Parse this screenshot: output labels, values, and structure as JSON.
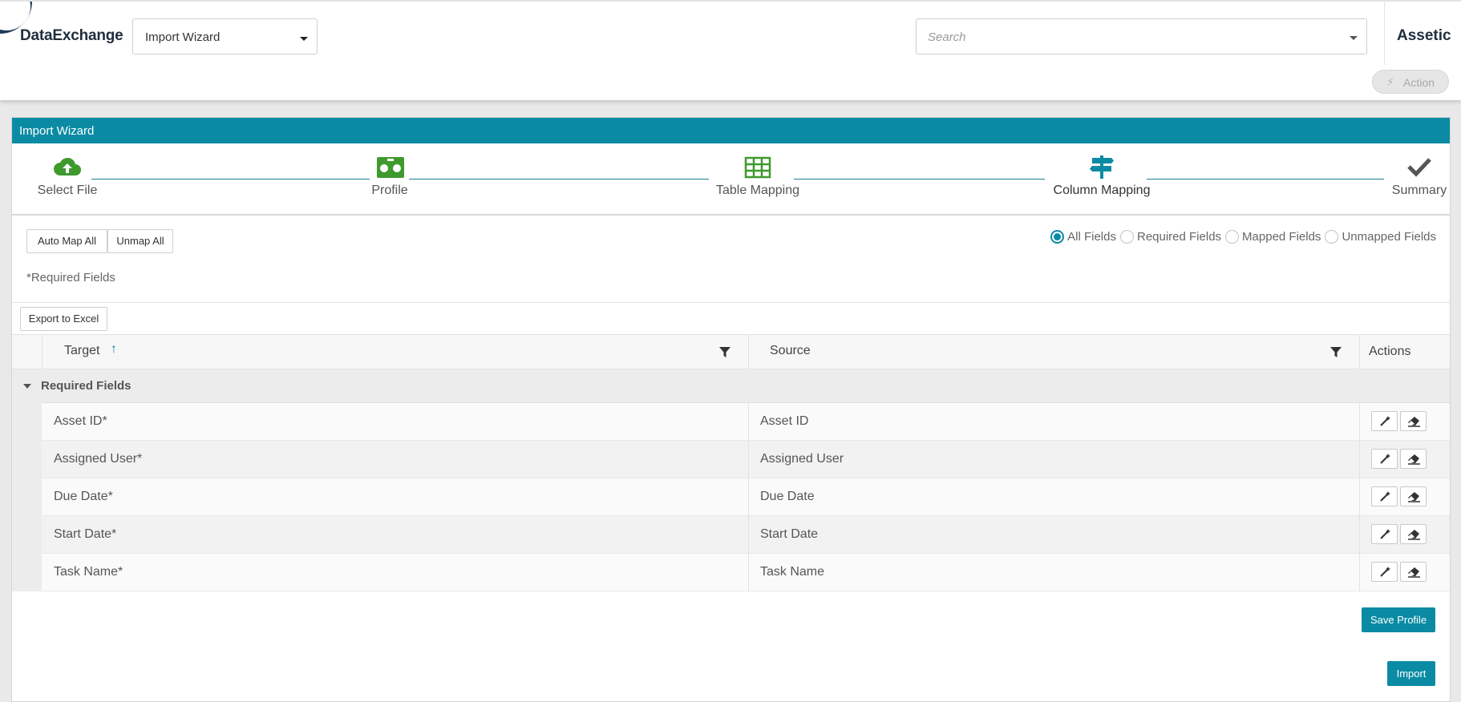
{
  "header": {
    "brand": "DataExchange",
    "module_select": "Import Wizard",
    "search_placeholder": "Search",
    "org_name": "Assetic"
  },
  "actionbar": {
    "action_label": "Action"
  },
  "panel": {
    "title": "Import Wizard"
  },
  "stepper": {
    "steps": [
      {
        "label": "Select File",
        "icon": "cloud-upload-icon",
        "color": "#3f9a2e"
      },
      {
        "label": "Profile",
        "icon": "profile-icon",
        "color": "#3f9a2e"
      },
      {
        "label": "Table Mapping",
        "icon": "table-icon",
        "color": "#3f9a2e"
      },
      {
        "label": "Column Mapping",
        "icon": "signpost-icon",
        "color": "#0a8ba3",
        "active": true
      },
      {
        "label": "Summary",
        "icon": "check-icon",
        "color": "#555555"
      }
    ]
  },
  "toolbar": {
    "auto_map_all": "Auto Map All",
    "unmap_all": "Unmap All",
    "required_note": "*Required Fields",
    "export_excel": "Export to Excel"
  },
  "filters": {
    "options": [
      "All Fields",
      "Required Fields",
      "Mapped Fields",
      "Unmapped Fields"
    ],
    "selected": "All Fields"
  },
  "grid": {
    "columns": {
      "target": "Target",
      "source": "Source",
      "actions": "Actions"
    },
    "group_label": "Required Fields",
    "rows": [
      {
        "target": "Asset ID*",
        "source": "Asset ID"
      },
      {
        "target": "Assigned User*",
        "source": "Assigned User"
      },
      {
        "target": "Due Date*",
        "source": "Due Date"
      },
      {
        "target": "Start Date*",
        "source": "Start Date"
      },
      {
        "target": "Task Name*",
        "source": "Task Name"
      }
    ]
  },
  "footer": {
    "save_profile": "Save Profile",
    "import": "Import"
  },
  "colors": {
    "accent": "#0a8ba3",
    "step_done": "#3f9a2e",
    "brand_dark": "#1f3a5a"
  }
}
